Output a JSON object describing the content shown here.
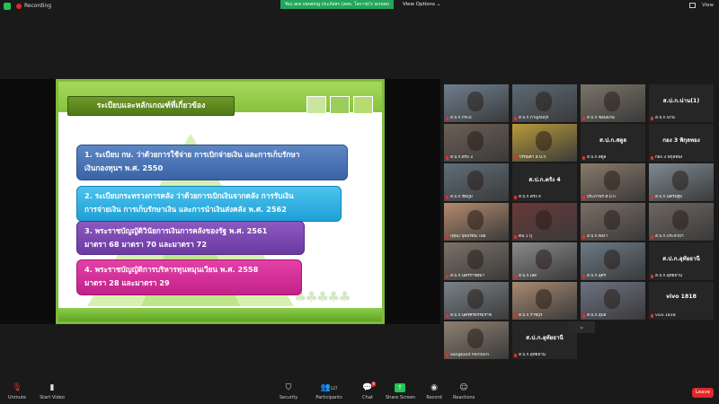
{
  "topbar": {
    "recording_label": "Recording",
    "banner": "You are viewing ประภัสสร (สสจ. โคราช)'s screen",
    "view_options": "View Options",
    "view": "View"
  },
  "slide": {
    "title": "ระเบียบและหลักเกณฑ์ที่เกี่ยวข้อง",
    "items": [
      {
        "line1": "1. ระเบียบ กษ. ว่าด้วยการใช้จ่าย การเบิกจ่ายเงิน และการเก็บรักษา",
        "line2": "เงินกองทุนฯ พ.ศ. 2550"
      },
      {
        "line1": "2. ระเบียบกระทรวงการคลัง ว่าด้วยการเบิกเงินจากคลัง การรับเงิน",
        "line2": "การจ่ายเงิน การเก็บรักษาเงิน และการนำเงินส่งคลัง พ.ศ. 2562"
      },
      {
        "line1": "3. พระราชบัญญัติวินัยการเงินการคลังของรัฐ พ.ศ. 2561",
        "line2": "มาตรา 68 มาตรา 70 และมาตรา 72"
      },
      {
        "line1": "4. พระราชบัญญัติการบริหารทุนหมุนเวียน พ.ศ. 2558",
        "line2": "มาตรา 28 และมาตรา 29"
      }
    ]
  },
  "participants": [
    {
      "name": "ส.ป.ก.กระบี่",
      "big": "",
      "color": "#6e7f8f"
    },
    {
      "name": "ส.ป.ก.กาญจนบุรี",
      "big": "",
      "color": "#5a6a74"
    },
    {
      "name": "ส.ป.ก.ขอนแก่น",
      "big": "",
      "color": "#7a7468"
    },
    {
      "name": "ส.ป.ก.น่าน",
      "big": "ส.ป.ก.น่าน(1)",
      "color": ""
    },
    {
      "name": "ส.ป.ก.ตรัง 3",
      "big": "",
      "color": "#6d5f55"
    },
    {
      "name": "วรรณิศา ส.ป.ก.",
      "big": "",
      "color": "#b89a3a"
    },
    {
      "name": "ส.ป.ก.สตูล",
      "big": "ส.ป.ก.สตูล",
      "color": ""
    },
    {
      "name": "กอง 3 พิกุลทอง",
      "big": "กอง 3 พิกุลทอง",
      "color": ""
    },
    {
      "name": "ส.ป.ก.ชัยภูมิ",
      "big": "",
      "color": "#5f6e78"
    },
    {
      "name": "ส.ป.ก.ตรัง 4",
      "big": "ส.ป.ก.ตรัง 4",
      "color": ""
    },
    {
      "name": "ประภาพร ส.ป.ก.",
      "big": "",
      "color": "#8a7a6a"
    },
    {
      "name": "ส.ป.ก.นครปฐม",
      "big": "",
      "color": "#7e8a92"
    },
    {
      "name": "(คุณ) บุษบรัตน์ โพธิ์",
      "big": "",
      "color": "#b48b6e"
    },
    {
      "name": "คน 1 บุ",
      "big": "",
      "color": "#6a3838"
    },
    {
      "name": "ส.ป.ก.พังงา",
      "big": "",
      "color": "#7a6e64"
    },
    {
      "name": "ส.ป.ก.ประจวบฯ",
      "big": "",
      "color": "#6e6660"
    },
    {
      "name": "ส.ป.ก.นครราชสีมา",
      "big": "",
      "color": "#7c7268"
    },
    {
      "name": "ส.ป.ก.เลย",
      "big": "",
      "color": "#8a8a8a"
    },
    {
      "name": "ส.ป.ก.อุดร",
      "big": "",
      "color": "#6a7a86"
    },
    {
      "name": "ส.ป.ก.อุทัยธานี",
      "big": "ส.ป.ก.อุทัยธานี",
      "color": ""
    },
    {
      "name": "ส.ป.ก.นครศรีธรรมราช",
      "big": "",
      "color": "#7a8288"
    },
    {
      "name": "ส.ป.ก.ราชบุรี",
      "big": "",
      "color": "#a88a72"
    },
    {
      "name": "ส.ป.ก.อุบล",
      "big": "",
      "color": "#6d7280"
    },
    {
      "name": "vivo 1818",
      "big": "vivo 1818",
      "color": ""
    },
    {
      "name": "Sangkasit Pomtern",
      "big": "",
      "color": "#8e8070"
    },
    {
      "name": "ส.ป.ก.อุทัยธานี",
      "big": "ส.ป.ก.อุทัยธานี",
      "color": ""
    }
  ],
  "toolbar": {
    "unmute": "Unmute",
    "start_video": "Start Video",
    "security": "Security",
    "participants": "Participants",
    "participants_count": "127",
    "chat": "Chat",
    "chat_badge": "9",
    "share_screen": "Share Screen",
    "record": "Record",
    "reactions": "Reactions",
    "leave": "Leave"
  },
  "colors": {
    "banner_green": "#23a55a",
    "leave_red": "#e02828",
    "slide_green": "#7dbb3c"
  }
}
